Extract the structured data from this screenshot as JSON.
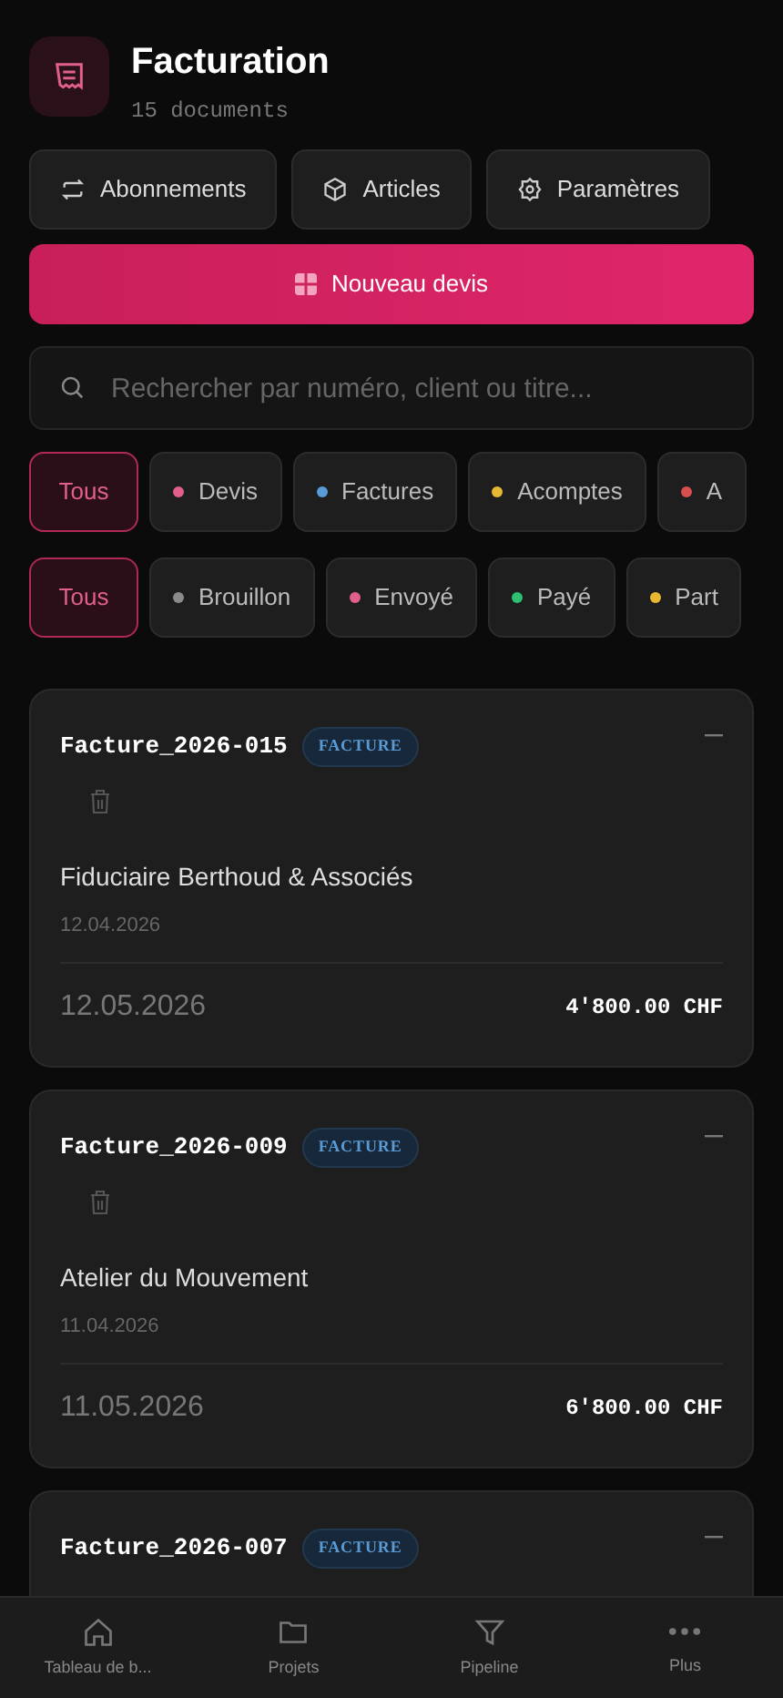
{
  "header": {
    "title": "Facturation",
    "subtitle": "15 documents"
  },
  "actions": [
    {
      "label": "Abonnements"
    },
    {
      "label": "Articles"
    },
    {
      "label": "Paramètres"
    }
  ],
  "primary_button": {
    "label": "Nouveau devis"
  },
  "search": {
    "placeholder": "Rechercher par numéro, client ou titre..."
  },
  "type_filters": [
    {
      "label": "Tous",
      "selected": true
    },
    {
      "label": "Devis",
      "selected": false,
      "color": "#e0608a"
    },
    {
      "label": "Factures",
      "selected": false,
      "color": "#5b9bd5"
    },
    {
      "label": "Acomptes",
      "selected": false,
      "color": "#e8b830"
    },
    {
      "label": "A",
      "selected": false,
      "color": "#d94f4f"
    }
  ],
  "status_filters": [
    {
      "label": "Tous",
      "selected": true
    },
    {
      "label": "Brouillon",
      "selected": false,
      "color": "#8a8a8a"
    },
    {
      "label": "Envoyé",
      "selected": false,
      "color": "#e0608a"
    },
    {
      "label": "Payé",
      "selected": false,
      "color": "#2fbf71"
    },
    {
      "label": "Part",
      "selected": false,
      "color": "#e8b830"
    }
  ],
  "documents": [
    {
      "number": "Facture_2026-015",
      "badge": "FACTURE",
      "client": "Fiduciaire Berthoud & Associés",
      "date": "12.04.2026",
      "due_date": "12.05.2026",
      "amount": "4'800.00 CHF"
    },
    {
      "number": "Facture_2026-009",
      "badge": "FACTURE",
      "client": "Atelier du Mouvement",
      "date": "11.04.2026",
      "due_date": "11.05.2026",
      "amount": "6'800.00 CHF"
    },
    {
      "number": "Facture_2026-007",
      "badge": "FACTURE"
    }
  ],
  "bottom_nav": [
    {
      "label": "Tableau de b..."
    },
    {
      "label": "Projets"
    },
    {
      "label": "Pipeline"
    },
    {
      "label": "Plus"
    }
  ]
}
